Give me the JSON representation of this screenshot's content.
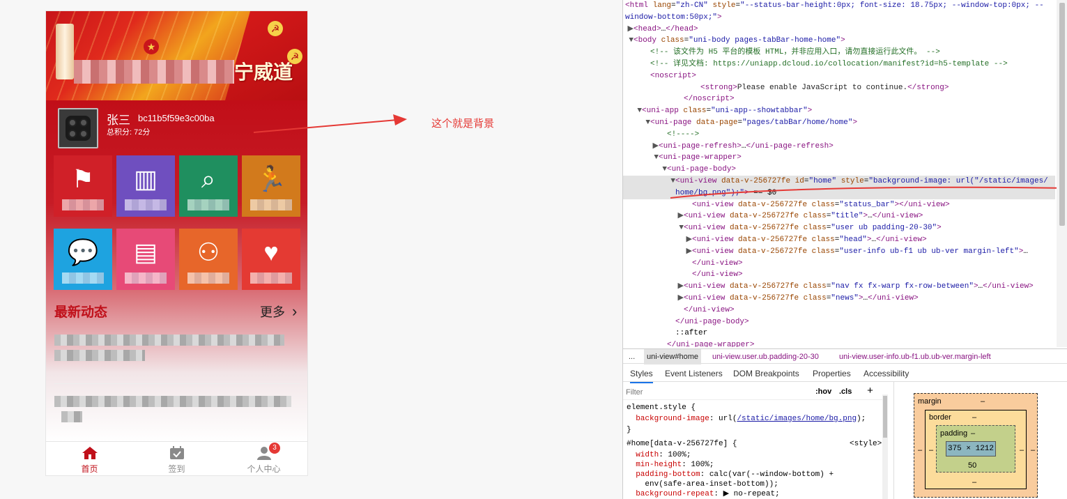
{
  "app": {
    "hero_title_visible": "宁威道",
    "user": {
      "name": "张三",
      "id": "bc11b5f59e3c00ba",
      "points": "总积分: 72分"
    },
    "nav_tiles": [
      {
        "icon": "party-flag-icon",
        "color": "#d02028"
      },
      {
        "icon": "book-icon",
        "color": "#6f4fbf"
      },
      {
        "icon": "search-icon",
        "color": "#1f8f5f"
      },
      {
        "icon": "runner-icon",
        "color": "#d27a1c"
      },
      {
        "icon": "chat-icon",
        "color": "#1ea3e0"
      },
      {
        "icon": "notebook-icon",
        "color": "#e74a77"
      },
      {
        "icon": "meeting-icon",
        "color": "#e7662a"
      },
      {
        "icon": "laptop-heart-icon",
        "color": "#e43a33"
      }
    ],
    "news": {
      "title": "最新动态",
      "more": "更多"
    },
    "tabbar": {
      "home": "首页",
      "checkin": "签到",
      "profile": "个人中心",
      "badge": "3"
    }
  },
  "annotation": "这个就是背景",
  "devtools": {
    "dom_lines": [
      {
        "indent": 0,
        "arrow": "",
        "html": "<span class='tag'>&lt;html</span> <span class='attr'>lang</span>=<span class='val'>\"zh-CN\"</span> <span class='attr'>style</span>=<span class='val'>\"--status-bar-height:0px; font-size: 18.75px; --window-top:0px; --</span>"
      },
      {
        "indent": 0,
        "arrow": "",
        "html": "<span class='val'>window-bottom:50px;\"</span><span class='tag'>&gt;</span>"
      },
      {
        "indent": 1,
        "arrow": "▶",
        "html": "<span class='tag'>&lt;head&gt;</span>…<span class='tag'>&lt;/head&gt;</span>"
      },
      {
        "indent": 1,
        "arrow": "▼",
        "html": "<span class='tag'>&lt;body</span> <span class='attr'>class</span>=<span class='val'>\"uni-body pages-tabBar-home-home\"</span><span class='tag'>&gt;</span>"
      },
      {
        "indent": 3,
        "arrow": "",
        "html": "<span class='cm'>&lt;!-- 该文件为 H5 平台的模板 HTML，并非应用入口，请勿直接运行此文件。 --&gt;</span>"
      },
      {
        "indent": 3,
        "arrow": "",
        "html": "<span class='cm'>&lt;!-- 详见文档: https://uniapp.dcloud.io/collocation/manifest?id=h5-template --&gt;</span>"
      },
      {
        "indent": 3,
        "arrow": "",
        "html": "<span class='tag'>&lt;noscript&gt;</span>"
      },
      {
        "indent": 9,
        "arrow": "",
        "html": "<span class='tag'>&lt;strong&gt;</span><span class='txt'>Please enable JavaScript to continue.</span><span class='tag'>&lt;/strong&gt;</span>"
      },
      {
        "indent": 7,
        "arrow": "",
        "html": "<span class='tag'>&lt;/noscript&gt;</span>"
      },
      {
        "indent": 2,
        "arrow": "▼",
        "html": "<span class='tag'>&lt;uni-app</span> <span class='attr'>class</span>=<span class='val'>\"uni-app--showtabbar\"</span><span class='tag'>&gt;</span>"
      },
      {
        "indent": 3,
        "arrow": "▼",
        "html": "<span class='tag'>&lt;uni-page</span> <span class='attr'>data-page</span>=<span class='val'>\"pages/tabBar/home/home\"</span><span class='tag'>&gt;</span>"
      },
      {
        "indent": 5,
        "arrow": "",
        "html": "<span class='cm'>&lt;!----&gt;</span>"
      },
      {
        "indent": 4,
        "arrow": "▶",
        "html": "<span class='tag'>&lt;uni-page-refresh&gt;</span>…<span class='tag'>&lt;/uni-page-refresh&gt;</span>"
      },
      {
        "indent": 4,
        "arrow": "▼",
        "html": "<span class='tag'>&lt;uni-page-wrapper&gt;</span>"
      },
      {
        "indent": 5,
        "arrow": "▼",
        "html": "<span class='tag'>&lt;uni-page-body&gt;</span>"
      },
      {
        "indent": 6,
        "arrow": "▼",
        "html": "<span class='tag'>&lt;uni-view</span> <span class='attr'>data-v-256727fe</span> <span class='attr'>id</span>=<span class='val'>\"home\"</span> <span class='attr'>style</span>=<span class='val'>\"background-image: url(\"/static/images/</span>",
        "hl": true
      },
      {
        "indent": 6,
        "arrow": "",
        "html": "<span class='val'>home/bg.png\");\"</span><span class='tag'>&gt;</span> == $0",
        "hl": true
      },
      {
        "indent": 8,
        "arrow": "",
        "html": "<span class='tag'>&lt;uni-view</span> <span class='attr'>data-v-256727fe</span> <span class='attr'>class</span>=<span class='val'>\"status_bar\"</span><span class='tag'>&gt;&lt;/uni-view&gt;</span>"
      },
      {
        "indent": 7,
        "arrow": "▶",
        "html": "<span class='tag'>&lt;uni-view</span> <span class='attr'>data-v-256727fe</span> <span class='attr'>class</span>=<span class='val'>\"title\"</span><span class='tag'>&gt;</span>…<span class='tag'>&lt;/uni-view&gt;</span>"
      },
      {
        "indent": 7,
        "arrow": "▼",
        "html": "<span class='tag'>&lt;uni-view</span> <span class='attr'>data-v-256727fe</span> <span class='attr'>class</span>=<span class='val'>\"user ub padding-20-30\"</span><span class='tag'>&gt;</span>"
      },
      {
        "indent": 8,
        "arrow": "▶",
        "html": "<span class='tag'>&lt;uni-view</span> <span class='attr'>data-v-256727fe</span> <span class='attr'>class</span>=<span class='val'>\"head\"</span><span class='tag'>&gt;</span>…<span class='tag'>&lt;/uni-view&gt;</span>"
      },
      {
        "indent": 8,
        "arrow": "▶",
        "html": "<span class='tag'>&lt;uni-view</span> <span class='attr'>data-v-256727fe</span> <span class='attr'>class</span>=<span class='val'>\"user-info ub-f1 ub ub-ver margin-left\"</span><span class='tag'>&gt;</span>…"
      },
      {
        "indent": 8,
        "arrow": "",
        "html": "<span class='tag'>&lt;/uni-view&gt;</span>"
      },
      {
        "indent": 8,
        "arrow": "",
        "html": "<span class='tag'>&lt;/uni-view&gt;</span>"
      },
      {
        "indent": 7,
        "arrow": "▶",
        "html": "<span class='tag'>&lt;uni-view</span> <span class='attr'>data-v-256727fe</span> <span class='attr'>class</span>=<span class='val'>\"nav fx fx-warp fx-row-between\"</span><span class='tag'>&gt;</span>…<span class='tag'>&lt;/uni-view&gt;</span>"
      },
      {
        "indent": 7,
        "arrow": "▶",
        "html": "<span class='tag'>&lt;uni-view</span> <span class='attr'>data-v-256727fe</span> <span class='attr'>class</span>=<span class='val'>\"news\"</span><span class='tag'>&gt;</span>…<span class='tag'>&lt;/uni-view&gt;</span>"
      },
      {
        "indent": 7,
        "arrow": "",
        "html": "<span class='tag'>&lt;/uni-view&gt;</span>"
      },
      {
        "indent": 6,
        "arrow": "",
        "html": "<span class='tag'>&lt;/uni-page-body&gt;</span>"
      },
      {
        "indent": 6,
        "arrow": "",
        "html": "::after"
      },
      {
        "indent": 5,
        "arrow": "",
        "html": "<span class='tag'>&lt;/uni-page-wrapper&gt;</span>"
      }
    ],
    "breadcrumb": [
      "...",
      "uni-view#home",
      "uni-view.user.ub.padding-20-30",
      "uni-view.user-info.ub-f1.ub.ub-ver.margin-left"
    ],
    "panel_tabs": [
      "Styles",
      "Event Listeners",
      "DOM Breakpoints",
      "Properties",
      "Accessibility"
    ],
    "filter_placeholder": "Filter",
    "hov": ":hov",
    "cls": ".cls",
    "plus": "+",
    "style_lines": [
      {
        "html": "element.style {"
      },
      {
        "html": "&nbsp;&nbsp;<span class='prop'>background-image</span>: url(<span class='link'>/static/images/home/bg.png</span>);"
      },
      {
        "html": "}"
      },
      {
        "html": "#home[data-v-256727fe] {<span style='position:absolute;left:320px'>&lt;style&gt;</span>"
      },
      {
        "html": "&nbsp;&nbsp;<span class='prop'>width</span>: 100%;"
      },
      {
        "html": "&nbsp;&nbsp;<span class='prop'>min-height</span>: 100%;"
      },
      {
        "html": "&nbsp;&nbsp;<span class='prop'>padding-bottom</span>: calc(var(--window-bottom) +"
      },
      {
        "html": "&nbsp;&nbsp;&nbsp;&nbsp;env(safe-area-inset-bottom));"
      },
      {
        "html": "&nbsp;&nbsp;<span class='prop'>background-repeat</span>: ▶ no-repeat;"
      }
    ],
    "box_model": {
      "margin_label": "margin",
      "margin_value": "–",
      "border_label": "border",
      "border_value": "–",
      "padding_label": "padding",
      "padding_value": "–",
      "content": "375 × 1212",
      "padding_bottom": "50",
      "side_value": "–"
    }
  }
}
